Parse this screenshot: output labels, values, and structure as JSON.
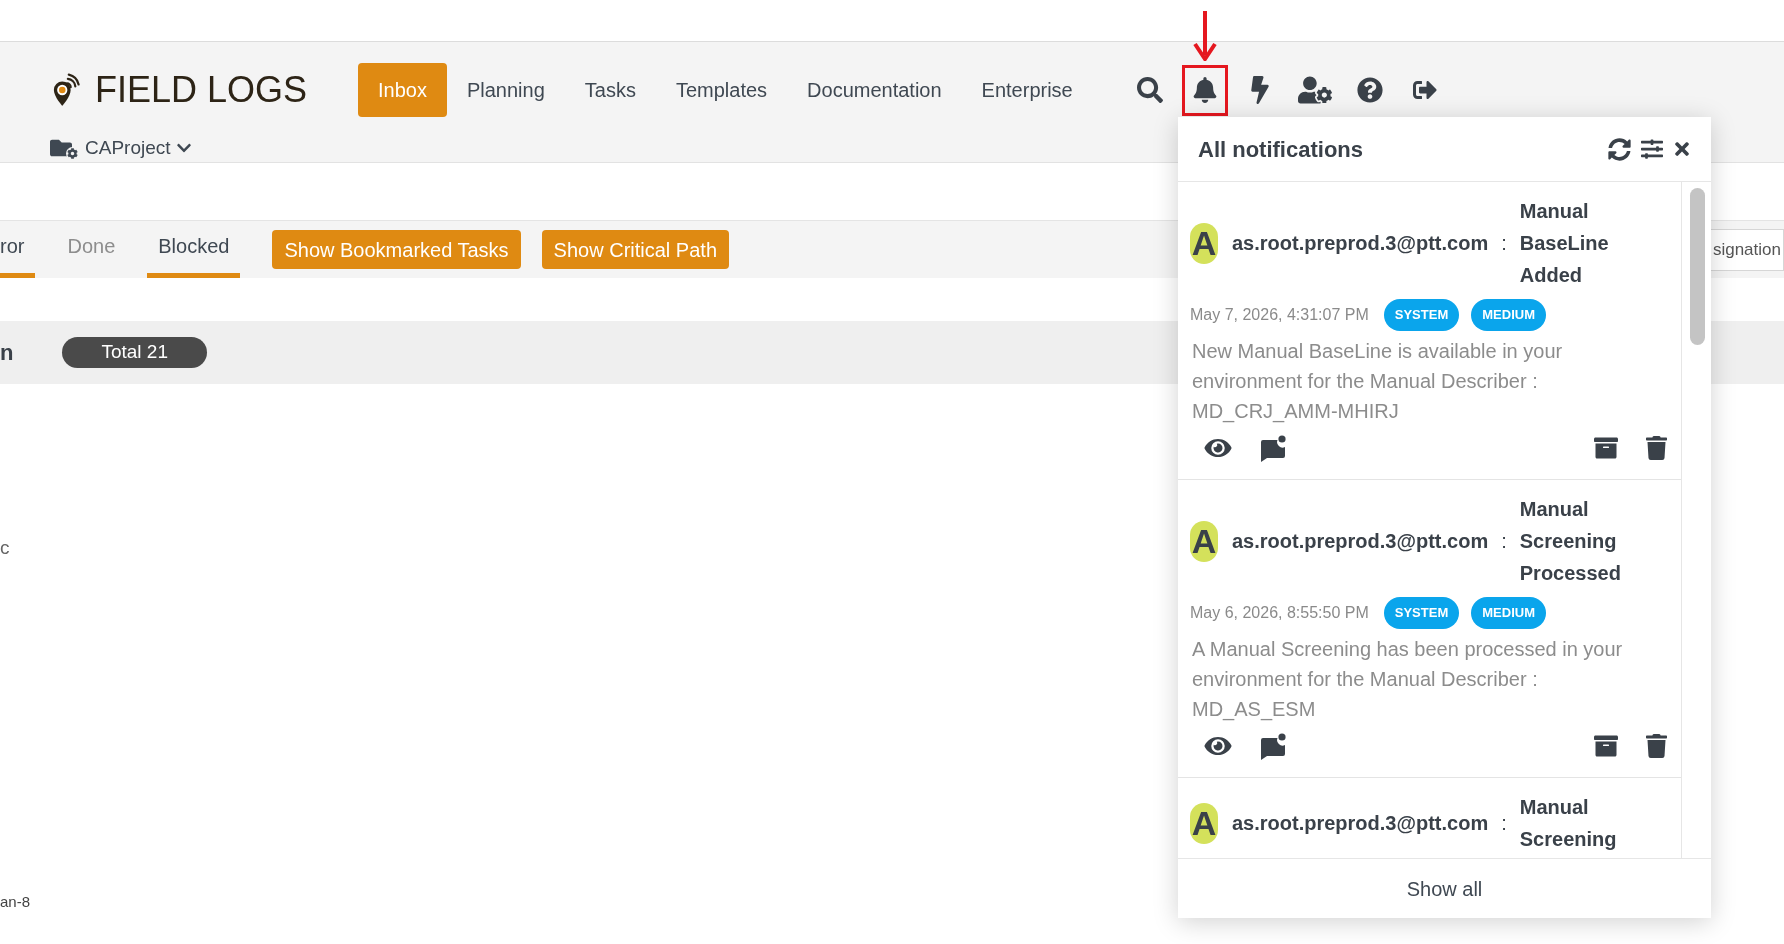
{
  "header": {
    "logo": "FIELD LOGS",
    "nav": [
      {
        "label": "Inbox",
        "selected": true
      },
      {
        "label": "Planning",
        "selected": false
      },
      {
        "label": "Tasks",
        "selected": false
      },
      {
        "label": "Templates",
        "selected": false
      },
      {
        "label": "Documentation",
        "selected": false
      },
      {
        "label": "Enterprise",
        "selected": false
      }
    ],
    "icons": [
      {
        "kind": "search",
        "highlighted": false
      },
      {
        "kind": "bell",
        "highlighted": true
      },
      {
        "kind": "bolt",
        "highlighted": false
      },
      {
        "kind": "user-gear",
        "highlighted": false
      },
      {
        "kind": "help",
        "highlighted": false
      },
      {
        "kind": "sign-out",
        "highlighted": false
      }
    ],
    "project": "CAProject"
  },
  "tabs": [
    {
      "label": "ror",
      "selected": true
    },
    {
      "label": "Done",
      "selected": false
    },
    {
      "label": "Blocked",
      "selected": true
    }
  ],
  "toolbar_buttons": [
    "Show Bookmarked Tasks",
    "Show Critical Path"
  ],
  "filter_field": {
    "value": "signation"
  },
  "summary": {
    "heading": "n",
    "total": "Total 21"
  },
  "rows": [
    "c",
    "an-8"
  ],
  "notifications": {
    "title": "All notifications",
    "items": [
      {
        "avatar": "A",
        "sender": "as.root.preprod.3@ptt.com",
        "separator": ":",
        "title": "Manual BaseLine Added",
        "time": "May 7, 2026, 4:31:07 PM",
        "tags": [
          "SYSTEM",
          "MEDIUM"
        ],
        "message": "New Manual BaseLine is available in your environment for the Manual Describer : MD_CRJ_AMM-MHIRJ"
      },
      {
        "avatar": "A",
        "sender": "as.root.preprod.3@ptt.com",
        "separator": ":",
        "title": "Manual Screening Processed",
        "time": "May 6, 2026, 8:55:50 PM",
        "tags": [
          "SYSTEM",
          "MEDIUM"
        ],
        "message": "A Manual Screening has been processed in your environment for the Manual Describer : MD_AS_ESM"
      },
      {
        "avatar": "A",
        "sender": "as.root.preprod.3@ptt.com",
        "separator": ":",
        "title": "Manual Screening"
      }
    ],
    "footer": "Show all"
  }
}
